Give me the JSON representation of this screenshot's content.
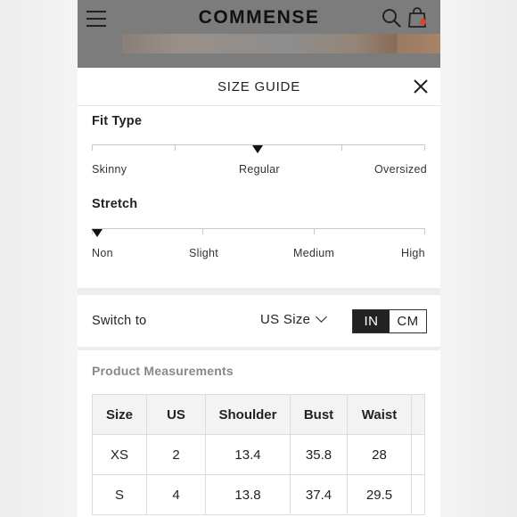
{
  "header": {
    "logo": "COMMENSE"
  },
  "size_guide": {
    "title": "SIZE GUIDE"
  },
  "fit_type": {
    "label": "Fit Type",
    "options": [
      "Skinny",
      "Regular",
      "Oversized"
    ],
    "selected": "Regular"
  },
  "stretch": {
    "label": "Stretch",
    "options": [
      "Non",
      "Slight",
      "Medium",
      "High"
    ],
    "selected": "Non"
  },
  "switch": {
    "label": "Switch to",
    "size_system": "US Size",
    "units": [
      "IN",
      "CM"
    ],
    "active_unit": "IN"
  },
  "measurements": {
    "title": "Product Measurements",
    "columns": [
      "Size",
      "US",
      "Shoulder",
      "Bust",
      "Waist"
    ],
    "rows": [
      [
        "XS",
        "2",
        "13.4",
        "35.8",
        "28"
      ],
      [
        "S",
        "4",
        "13.8",
        "37.4",
        "29.5"
      ]
    ]
  },
  "colors": {
    "accent_dark": "#222222",
    "cart_badge": "#d9432e",
    "overlay_dim": "#7c7c7c"
  },
  "icons": [
    "menu-icon",
    "search-icon",
    "shopping-bag-icon",
    "close-icon",
    "chevron-down-icon"
  ]
}
